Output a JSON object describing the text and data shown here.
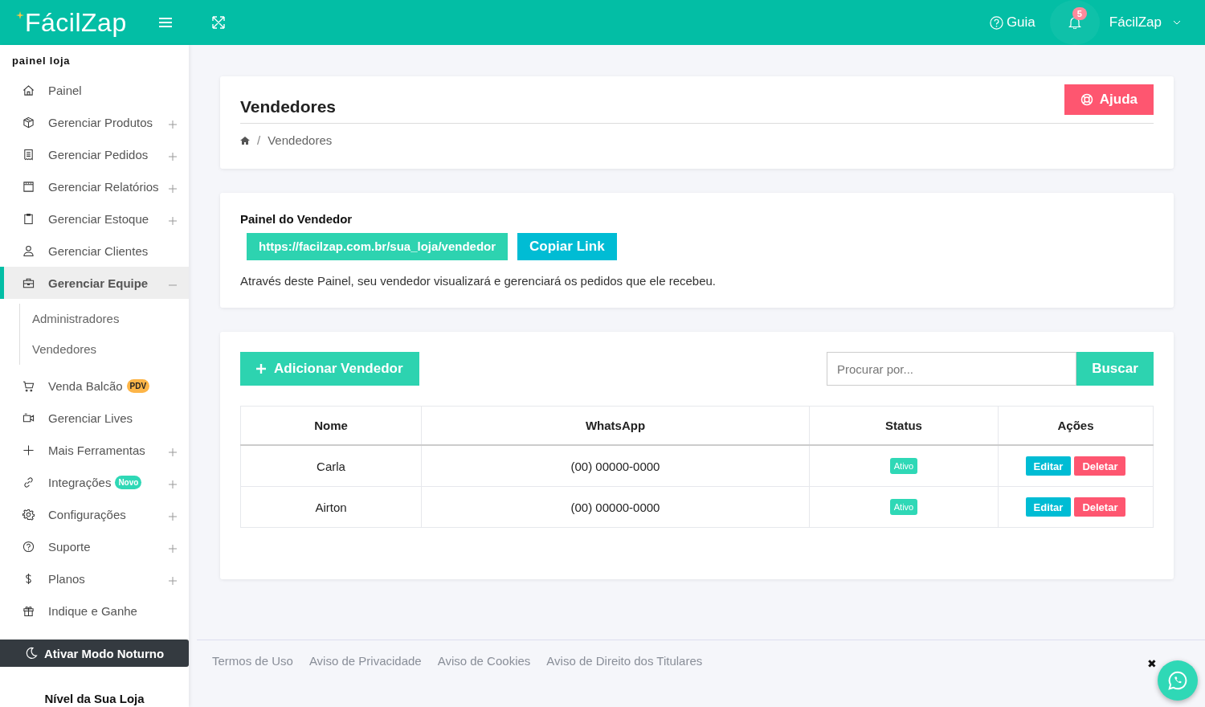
{
  "header": {
    "logo": "**Fácil**Zap",
    "guide": "Guia",
    "notification_count": "5",
    "user": "FácilZap"
  },
  "sidebar": {
    "section_title": "painel loja",
    "items": [
      {
        "label": "Painel",
        "selected": false
      },
      {
        "label": "Gerenciar Produtos",
        "selected": false,
        "expanded": false
      },
      {
        "label": "Gerenciar Pedidos",
        "selected": false,
        "expanded": false
      },
      {
        "label": "Gerenciar Relatórios",
        "selected": false,
        "expanded": false
      },
      {
        "label": "Gerenciar Estoque",
        "selected": false,
        "expanded": false
      },
      {
        "label": "Gerenciar Clientes",
        "selected": false
      },
      {
        "label": "Gerenciar Equipe",
        "selected": true,
        "expanded": true,
        "children": [
          {
            "label": "Administradores"
          },
          {
            "label": "Vendedores"
          }
        ]
      },
      {
        "label": "Venda Balcão",
        "selected": false,
        "badge": {
          "text": "PDV",
          "color": "#fdb548"
        }
      },
      {
        "label": "Gerenciar Lives",
        "selected": false
      },
      {
        "label": "Mais Ferramentas",
        "selected": false,
        "expanded": false
      },
      {
        "label": "Integrações",
        "selected": false,
        "expanded": false,
        "badge": {
          "text": "Novo",
          "color": "#2fd8b6"
        }
      },
      {
        "label": "Configurações",
        "selected": false,
        "expanded": false
      },
      {
        "label": "Suporte",
        "selected": false,
        "expanded": false
      },
      {
        "label": "Planos",
        "selected": false,
        "expanded": false
      },
      {
        "label": "Indique e Ganhe",
        "selected": false
      }
    ],
    "night_mode_button": "Ativar Modo Noturno",
    "store_level_title": "Nível da Sua Loja"
  },
  "page_header": {
    "title": "Vendedores",
    "help_button": "Ajuda",
    "breadcrumb": {
      "separator": "/",
      "items": [
        "Vendedores"
      ]
    }
  },
  "seller_panel": {
    "title": "Painel do Vendedor",
    "link": "https://facilzap.com.br/sua_loja/vendedor",
    "copy_button": "Copiar Link",
    "description": "Através deste Painel, seu vendedor visualizará e gerenciará os pedidos que ele recebeu."
  },
  "sellers": {
    "add_button": "Adicionar Vendedor",
    "search": {
      "placeholder": "Procurar por..."
    },
    "search_button": "Buscar",
    "table": {
      "columns": [
        "Nome",
        "WhatsApp",
        "Status",
        "Ações"
      ],
      "rows": [
        {
          "name": "Carla",
          "whatsapp": "(00) 00000-0000",
          "status": {
            "label": "Ativo",
            "active": true
          },
          "actions": [
            "Editar",
            "Deletar"
          ]
        },
        {
          "name": "Airton",
          "whatsapp": "(00) 00000-0000",
          "status": {
            "label": "Ativo",
            "active": true
          },
          "actions": [
            "Editar",
            "Deletar"
          ]
        }
      ]
    }
  },
  "footer": {
    "links": [
      "Termos de Uso",
      "Aviso de Privacidade",
      "Aviso de Cookies",
      "Aviso de Direito dos Titulares"
    ],
    "close": "✖"
  }
}
